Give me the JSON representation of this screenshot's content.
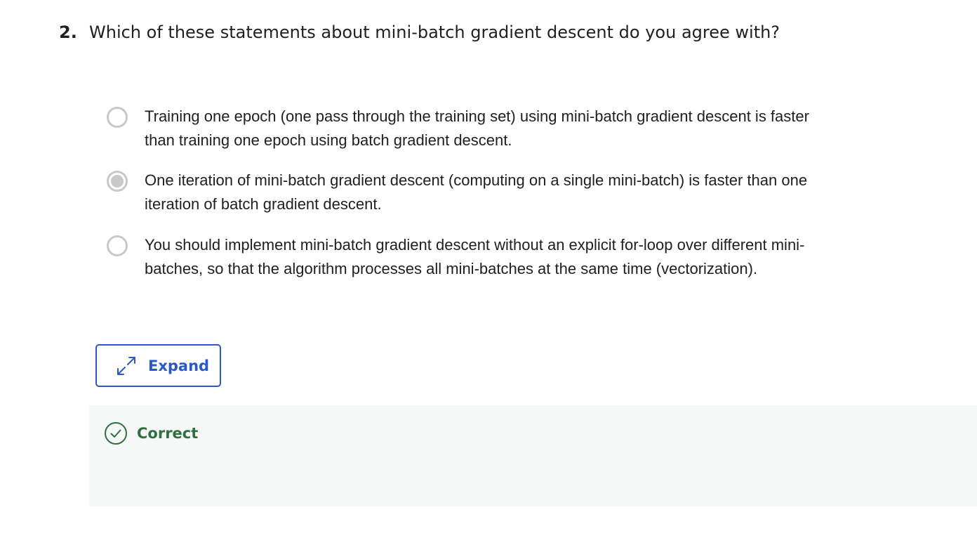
{
  "question": {
    "number": "2.",
    "text": "Which of these statements about mini-batch gradient descent do you agree with?"
  },
  "options": [
    {
      "text": "Training one epoch (one pass through the training set) using mini-batch gradient descent is faster than training one epoch using batch gradient descent.",
      "selected": false
    },
    {
      "text": "One iteration of mini-batch gradient descent (computing on a single mini-batch) is faster than one iteration of batch gradient descent.",
      "selected": true
    },
    {
      "text": "You should implement mini-batch gradient descent without an explicit for-loop over different mini-batches, so that the algorithm processes all mini-batches at the same time (vectorization).",
      "selected": false
    }
  ],
  "expand_button": {
    "label": "Expand",
    "icon": "expand-arrows-icon"
  },
  "feedback": {
    "status_label": "Correct",
    "icon": "check-circle-icon"
  },
  "colors": {
    "accent": "#2a58c7",
    "success": "#2f7040",
    "radio": "#c8c8c8",
    "feedback_bg": "#f6f8f7"
  }
}
